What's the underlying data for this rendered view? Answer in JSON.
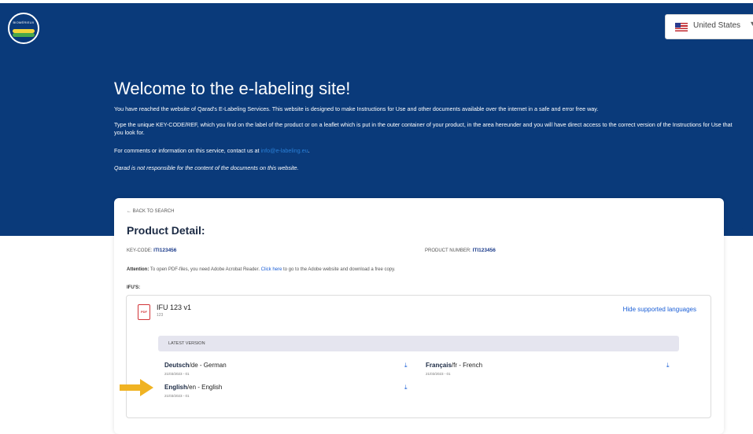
{
  "header": {
    "logo_text": "BIOMÉRIEUX",
    "country": {
      "label": "United States",
      "flag_icon": "us-flag-icon",
      "chevron_icon": "chevron-down-icon"
    }
  },
  "hero": {
    "title": "Welcome to the e-labeling site!",
    "p1": "You have reached the website of Qarad's E-Labeling Services. This website is designed to make Instructions for Use and other documents available over the internet in a safe and error free way.",
    "p2": "Type the unique KEY-CODE/REF, which you find on the label of the product or on a leaflet which is put in the outer container of your product, in the area hereunder and you will have direct access to the correct version of the Instructions for Use that you look for.",
    "p3_prefix": "For comments or information on this service, contact us at",
    "p3_link": "info@e-labeling.eu",
    "p3_suffix": ".",
    "p4": "Qarad is not responsible for the content of the documents on this website."
  },
  "product": {
    "back_label": "← BACK TO SEARCH",
    "title": "Product Detail:",
    "key_code_label": "KEY-CODE:",
    "key_code_value": "ITI123456",
    "product_number_label": "PRODUCT NUMBER:",
    "product_number_value": "ITI123456",
    "attention_label": "Attention:",
    "attention_text": "To open PDF-files, you need Adobe Acrobat Reader.",
    "attention_link": "Click here",
    "attention_suffix": "to go to the Adobe website and download a free copy.",
    "ifus_label": "IFU'S:",
    "ifu": {
      "icon_text": "PDF",
      "name": "IFU 123 v1",
      "sub": "123",
      "hide_label": "Hide supported languages",
      "latest_label": "LATEST VERSION",
      "languages": [
        {
          "name": "Deutsch",
          "code": "/de - German",
          "date": "21/03/2023 - 01"
        },
        {
          "name": "Français",
          "code": "/fr - French",
          "date": "21/03/2023 - 01"
        },
        {
          "name": "English",
          "code": "/en - English",
          "date": "21/03/2023 - 01"
        }
      ],
      "download_glyph": "⤓"
    }
  },
  "colors": {
    "hero_bg": "#0a3a7a",
    "link": "#1a5ed6",
    "annotation_arrow": "#f0b323"
  }
}
